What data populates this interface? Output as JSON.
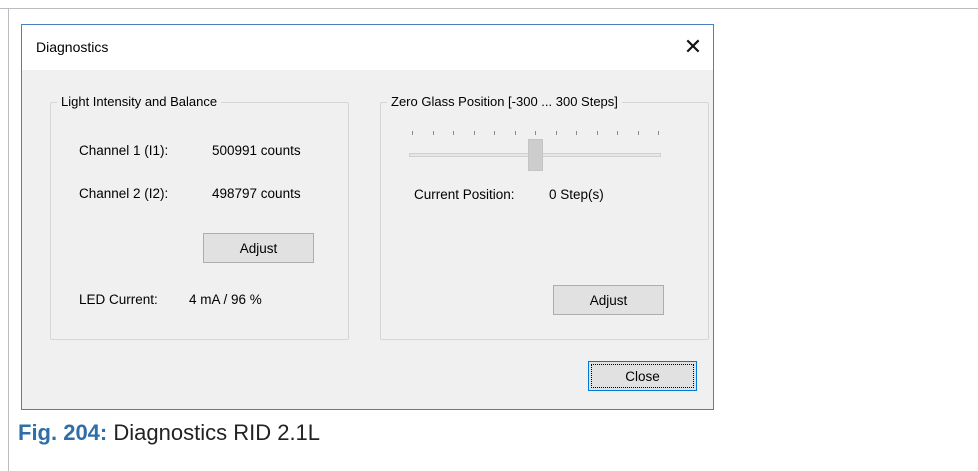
{
  "dialog": {
    "title": "Diagnostics",
    "close_glyph": "✕"
  },
  "light_group": {
    "title": "Light Intensity and Balance",
    "channel1_label": "Channel 1 (I1):",
    "channel1_value": "500991 counts",
    "channel2_label": "Channel 2 (I2):",
    "channel2_value": "498797 counts",
    "adjust_label": "Adjust",
    "led_label": "LED Current:",
    "led_value": "4 mA / 96 %"
  },
  "zero_group": {
    "title": "Zero Glass Position [-300 ... 300 Steps]",
    "slider": {
      "min": -300,
      "max": 300,
      "value": 0
    },
    "position_label": "Current Position:",
    "position_value": "0 Step(s)",
    "adjust_label": "Adjust"
  },
  "footer": {
    "close_label": "Close"
  },
  "caption": {
    "fig_label": "Fig. 204:",
    "text": "Diagnostics RID 2.1L"
  },
  "colors": {
    "window_border": "#4a7fc1",
    "caption_fig": "#2f6ea8",
    "dialog_bg": "#f0f0f0"
  }
}
